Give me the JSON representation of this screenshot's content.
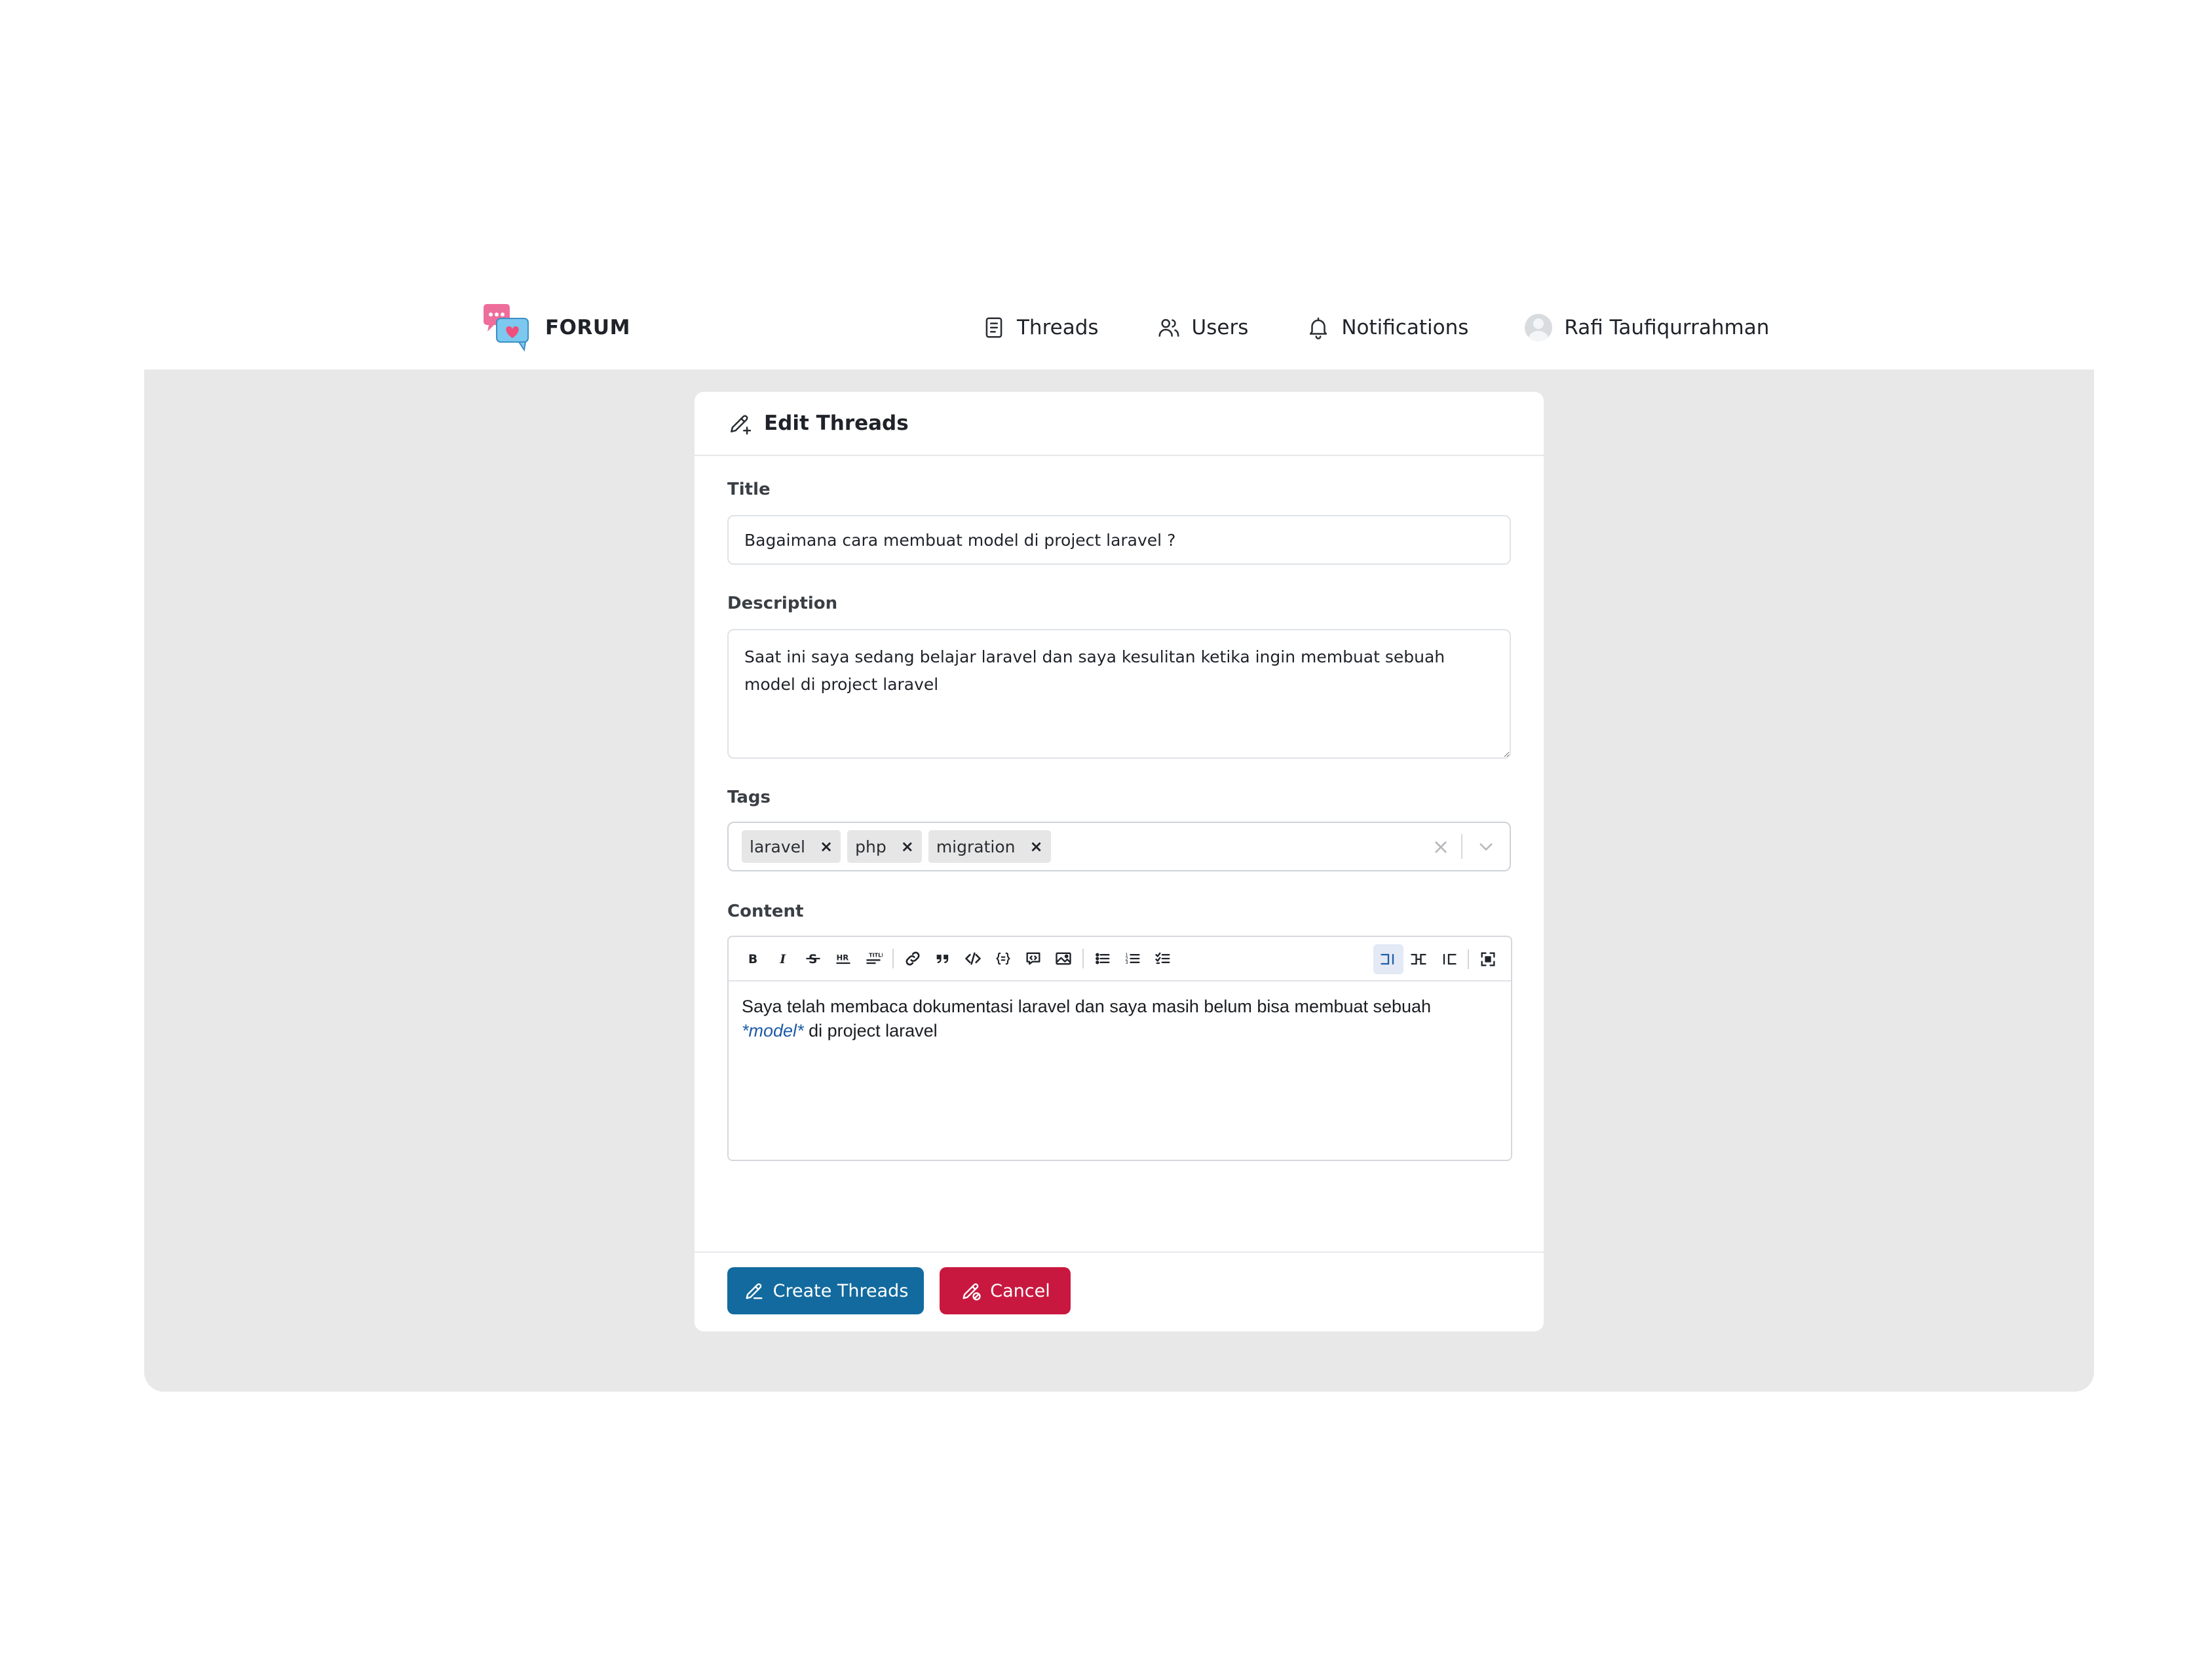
{
  "brand": {
    "name": "FORUM"
  },
  "nav": {
    "threads": "Threads",
    "users": "Users",
    "notifications": "Notifications",
    "user_name": "Rafi Taufiqurrahman"
  },
  "form": {
    "heading": "Edit Threads",
    "title_label": "Title",
    "title_value": "Bagaimana cara membuat model di project laravel ?",
    "description_label": "Description",
    "description_value": "Saat ini saya sedang belajar laravel dan saya kesulitan ketika ingin membuat sebuah model di project laravel",
    "tags_label": "Tags",
    "tags": [
      "laravel",
      "php",
      "migration"
    ],
    "content_label": "Content",
    "content": {
      "text_before": "Saya telah membaca dokumentasi laravel dan saya masih belum bisa membuat sebuah ",
      "emphasis": "*model*",
      "text_after": " di project laravel"
    },
    "toolbar_icons": [
      "bold-icon",
      "italic-icon",
      "strikethrough-icon",
      "horizontal-rule-icon",
      "title-icon",
      "link-icon",
      "quote-icon",
      "code-icon",
      "code-block-icon",
      "comment-icon",
      "image-icon",
      "unordered-list-icon",
      "ordered-list-icon",
      "checklist-icon",
      "edit-mode-icon",
      "live-mode-icon",
      "preview-mode-icon",
      "fullscreen-icon"
    ],
    "submit_label": "Create Threads",
    "cancel_label": "Cancel"
  },
  "colors": {
    "primary": "#126a9e",
    "danger": "#c8183f",
    "stage": "#e8e8e8"
  }
}
